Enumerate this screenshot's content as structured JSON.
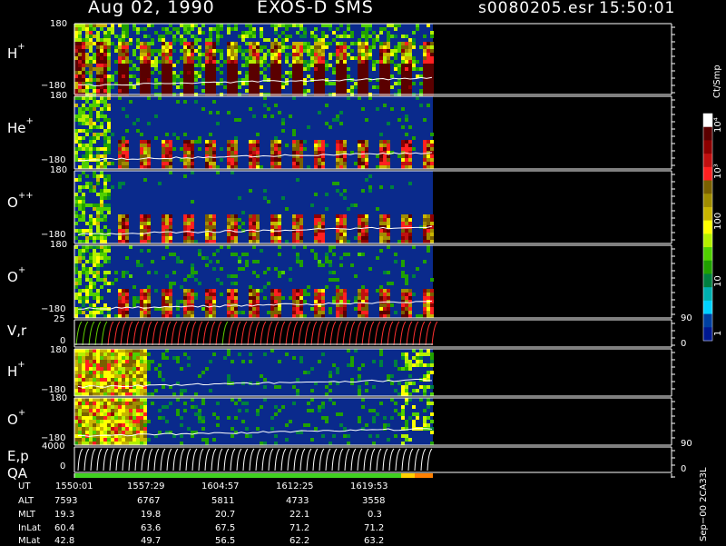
{
  "header": {
    "date": "Aug 02, 1990",
    "instrument": "EXOS-D SMS",
    "file": "s0080205.esr",
    "time": "15:50:01"
  },
  "panels": [
    {
      "id": "h-plus",
      "label": "H",
      "sup": "+",
      "ytop": "180",
      "ybot": "−180"
    },
    {
      "id": "he-plus",
      "label": "He",
      "sup": "+",
      "ytop": "180",
      "ybot": "−180"
    },
    {
      "id": "o-plusplus",
      "label": "O",
      "sup": "++",
      "ytop": "180",
      "ybot": "−180"
    },
    {
      "id": "o-plus",
      "label": "O",
      "sup": "+",
      "ytop": "180",
      "ybot": "−180"
    },
    {
      "id": "vr",
      "label": "V,r",
      "ytop": "25",
      "ybot": "0",
      "rtop": "90",
      "rbot": "0"
    },
    {
      "id": "h-plus-2",
      "label": "H",
      "sup": "+",
      "ytop": "180",
      "ybot": "−180"
    },
    {
      "id": "o-plus-2",
      "label": "O",
      "sup": "+",
      "ytop": "180",
      "ybot": "−180"
    },
    {
      "id": "ep",
      "label": "E,p",
      "ytop": "4000",
      "ybot": "0",
      "rtop": "90",
      "rbot": "0"
    },
    {
      "id": "qa",
      "label": "QA"
    }
  ],
  "colorbar": {
    "title": "Ct/Smp",
    "ticks": [
      "10⁴",
      "10³",
      "100",
      "10",
      "1"
    ],
    "colors": [
      "#ffffff",
      "#5a0000",
      "#8c0000",
      "#c01010",
      "#ff2020",
      "#7a6000",
      "#a08c00",
      "#c8b400",
      "#ffff00",
      "#b4f000",
      "#50d000",
      "#20a000",
      "#008040",
      "#00b0b0",
      "#00d0ff",
      "#0040a0",
      "#001890"
    ]
  },
  "footer": {
    "labels": [
      "UT",
      "ALT",
      "MLT",
      "InLat",
      "MLat"
    ],
    "columns": [
      [
        "1550:01",
        "7593",
        "19.3",
        "60.4",
        "42.8"
      ],
      [
        "1557:29",
        "6767",
        "19.8",
        "63.6",
        "49.7"
      ],
      [
        "1604:57",
        "5811",
        "20.7",
        "67.5",
        "56.5"
      ],
      [
        "1612:25",
        "4733",
        "22.1",
        "71.2",
        "62.2"
      ],
      [
        "1619:53",
        "3558",
        "0.3",
        "71.2",
        "63.2"
      ]
    ],
    "version": "Sep−00  2CA33L"
  },
  "chart_data": {
    "type": "heatmap",
    "title": "Aug 02, 1990   EXOS-D SMS",
    "subtitle": "s0080205.esr  15:50:01",
    "x_ticks": [
      "1550:01",
      "1557:29",
      "1604:57",
      "1612:25",
      "1619:53"
    ],
    "y_range_angle": [
      -180,
      180
    ],
    "colorbar_unit": "Ct/Smp",
    "colorbar_scale": "log",
    "colorbar_range": [
      1,
      10000
    ],
    "series": [
      {
        "name": "H+",
        "y_range": [
          -180,
          180
        ]
      },
      {
        "name": "He+",
        "y_range": [
          -180,
          180
        ]
      },
      {
        "name": "O++",
        "y_range": [
          -180,
          180
        ]
      },
      {
        "name": "O+",
        "y_range": [
          -180,
          180
        ]
      },
      {
        "name": "V,r",
        "y_range": [
          0,
          25
        ],
        "right_range": [
          0,
          90
        ]
      },
      {
        "name": "H+",
        "y_range": [
          -180,
          180
        ]
      },
      {
        "name": "O+",
        "y_range": [
          -180,
          180
        ]
      },
      {
        "name": "E,p",
        "y_range": [
          0,
          4000
        ],
        "right_range": [
          0,
          90
        ]
      },
      {
        "name": "QA"
      }
    ]
  }
}
